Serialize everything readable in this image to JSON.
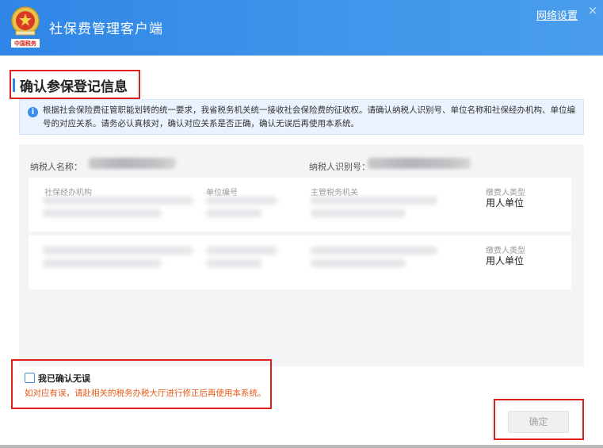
{
  "window": {
    "title": "社保费管理客户端",
    "network_settings": "网络设置",
    "close_symbol": "×",
    "logo_caption": "中国税务"
  },
  "page": {
    "heading": "确认参保登记信息",
    "notice_icon": "i",
    "notice": "根据社会保险费征管职能划转的统一要求，我省税务机关统一接收社会保险费的征收权。请确认纳税人识别号、单位名称和社保经办机构、单位编号的对应关系。请务必认真核对，确认对应关系是否正确，确认无误后再使用本系统。"
  },
  "taxpayer": {
    "name_label": "纳税人名称：",
    "id_label": "纳税人识别号："
  },
  "records": {
    "columns": [
      "社保经办机构",
      "单位编号",
      "主管税务机关"
    ],
    "payer_type_label": "缴费人类型",
    "rows": [
      {
        "payer_type": "用人单位"
      },
      {
        "payer_type": "用人单位"
      }
    ]
  },
  "confirm": {
    "label": "我已确认无误",
    "hint": "如对应有误，请赴相关的税务办税大厅进行修正后再使用本系统。",
    "checked": false
  },
  "actions": {
    "ok_label": "确定"
  },
  "colors": {
    "titlebar": "#2f86e6",
    "highlight_border": "#e0201d",
    "hint": "#e45a18"
  }
}
